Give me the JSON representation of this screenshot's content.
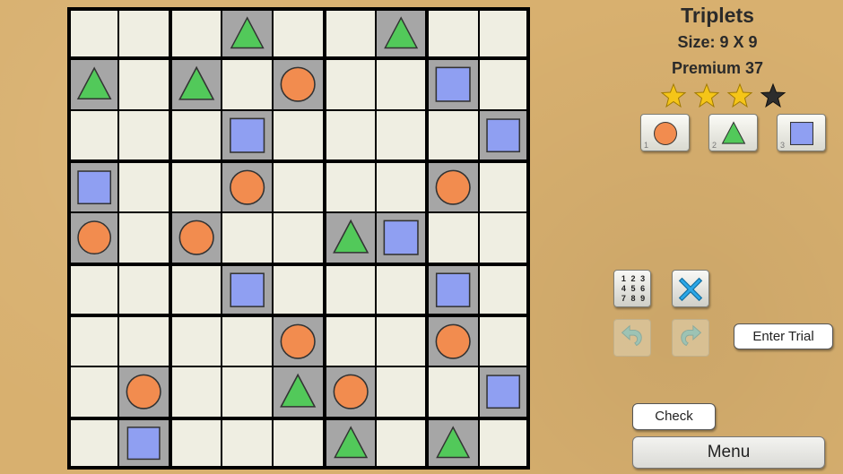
{
  "puzzle": {
    "title": "Triplets",
    "size_label": "Size: 9 X 9",
    "level_label": "Premium 37",
    "rating": {
      "filled": 3,
      "total": 4
    }
  },
  "board": {
    "rows": 9,
    "cols": 9,
    "vertical_region_borders": [
      2,
      5,
      7
    ],
    "horizontal_region_borders": [
      1,
      3,
      5,
      6,
      8
    ],
    "cells": [
      [
        null,
        null,
        null,
        "T",
        null,
        null,
        "T",
        null,
        null
      ],
      [
        "T",
        null,
        "T",
        null,
        "C",
        null,
        null,
        "S",
        null
      ],
      [
        null,
        null,
        null,
        "S",
        null,
        null,
        null,
        null,
        "S"
      ],
      [
        "S",
        null,
        null,
        "C",
        null,
        null,
        null,
        "C",
        null
      ],
      [
        "C",
        null,
        "C",
        null,
        null,
        "T",
        "S",
        null,
        null
      ],
      [
        null,
        null,
        null,
        "S",
        null,
        null,
        null,
        "S",
        null
      ],
      [
        null,
        null,
        null,
        null,
        "C",
        null,
        null,
        "C",
        null
      ],
      [
        null,
        "C",
        null,
        null,
        "T",
        "C",
        null,
        null,
        "S"
      ],
      [
        null,
        "S",
        null,
        null,
        null,
        "T",
        null,
        "T",
        null
      ]
    ]
  },
  "colors": {
    "circle": "#f28c4f",
    "triangle": "#52c95a",
    "square": "#8f9ff2",
    "empty_cell": "#efeee2",
    "given_cell": "#a6a6a6",
    "star_filled": "#f5c518",
    "star_empty": "#2d2d2d"
  },
  "symbol_buttons": [
    {
      "number": "1",
      "shape": "circle"
    },
    {
      "number": "2",
      "shape": "triangle"
    },
    {
      "number": "3",
      "shape": "square"
    }
  ],
  "tools": {
    "number_pad": [
      "1",
      "2",
      "3",
      "4",
      "5",
      "6",
      "7",
      "8",
      "9"
    ],
    "clear_icon": "x-icon",
    "undo_icon": "undo-arrow-icon",
    "redo_icon": "redo-arrow-icon"
  },
  "buttons": {
    "enter_trial": "Enter Trial",
    "check": "Check",
    "menu": "Menu"
  }
}
